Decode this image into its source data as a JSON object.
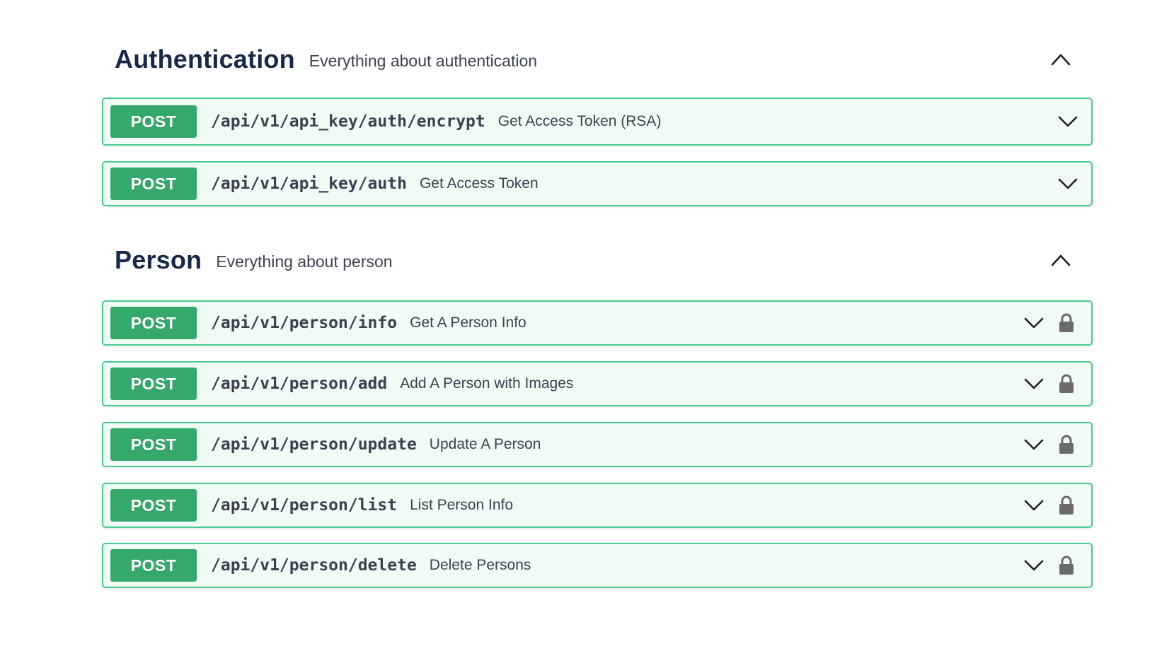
{
  "sections": [
    {
      "title": "Authentication",
      "description": "Everything about authentication",
      "toggle_icon": "chevron-up-icon",
      "operations": [
        {
          "method": "POST",
          "path": "/api/v1/api_key/auth/encrypt",
          "summary": "Get Access Token (RSA)",
          "locked": false
        },
        {
          "method": "POST",
          "path": "/api/v1/api_key/auth",
          "summary": "Get Access Token",
          "locked": false
        }
      ]
    },
    {
      "title": "Person",
      "description": "Everything about person",
      "toggle_icon": "chevron-up-icon",
      "operations": [
        {
          "method": "POST",
          "path": "/api/v1/person/info",
          "summary": "Get A Person Info",
          "locked": true
        },
        {
          "method": "POST",
          "path": "/api/v1/person/add",
          "summary": "Add A Person with Images",
          "locked": true
        },
        {
          "method": "POST",
          "path": "/api/v1/person/update",
          "summary": "Update A Person",
          "locked": true
        },
        {
          "method": "POST",
          "path": "/api/v1/person/list",
          "summary": "List Person Info",
          "locked": true
        },
        {
          "method": "POST",
          "path": "/api/v1/person/delete",
          "summary": "Delete Persons",
          "locked": true
        }
      ]
    }
  ],
  "colors": {
    "post_border": "#49cc90",
    "post_badge": "#34a96b",
    "title": "#17294a",
    "text": "#3b4151",
    "icon": "#6b6b6b"
  }
}
